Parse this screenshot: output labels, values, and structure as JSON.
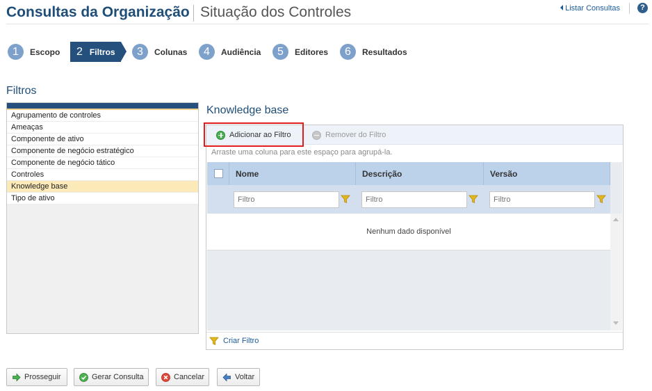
{
  "header": {
    "title": "Consultas da Organização",
    "subtitle": "Situação dos Controles",
    "list_link": "Listar Consultas",
    "help_glyph": "?"
  },
  "steps": [
    {
      "num": "1",
      "label": "Escopo",
      "active": false
    },
    {
      "num": "2",
      "label": "Filtros",
      "active": true
    },
    {
      "num": "3",
      "label": "Colunas",
      "active": false
    },
    {
      "num": "4",
      "label": "Audiência",
      "active": false
    },
    {
      "num": "5",
      "label": "Editores",
      "active": false
    },
    {
      "num": "6",
      "label": "Resultados",
      "active": false
    }
  ],
  "filters_panel": {
    "title": "Filtros",
    "items": [
      "Agrupamento de controles",
      "Ameaças",
      "Componente de ativo",
      "Componente de negócio estratégico",
      "Componente de negócio tático",
      "Controles",
      "Knowledge base",
      "Tipo de ativo"
    ],
    "selected": "Knowledge base"
  },
  "grid": {
    "title": "Knowledge base",
    "toolbar": {
      "add_label": "Adicionar ao Filtro",
      "remove_label": "Remover do Filtro"
    },
    "group_hint": "Arraste uma coluna para este espaço para agrupá-la.",
    "columns": [
      "Nome",
      "Descrição",
      "Versão"
    ],
    "filter_placeholder": "Filtro",
    "no_data": "Nenhum dado disponível",
    "create_filter": "Criar Filtro"
  },
  "buttons": {
    "proceed": "Prosseguir",
    "generate": "Gerar Consulta",
    "cancel": "Cancelar",
    "back": "Voltar"
  },
  "colors": {
    "brand_blue": "#1f4e79",
    "active_step": "#25507d",
    "step_circle": "#7ea1cc",
    "selected_row": "#fbe9b7",
    "highlight": "#e01c1c"
  }
}
